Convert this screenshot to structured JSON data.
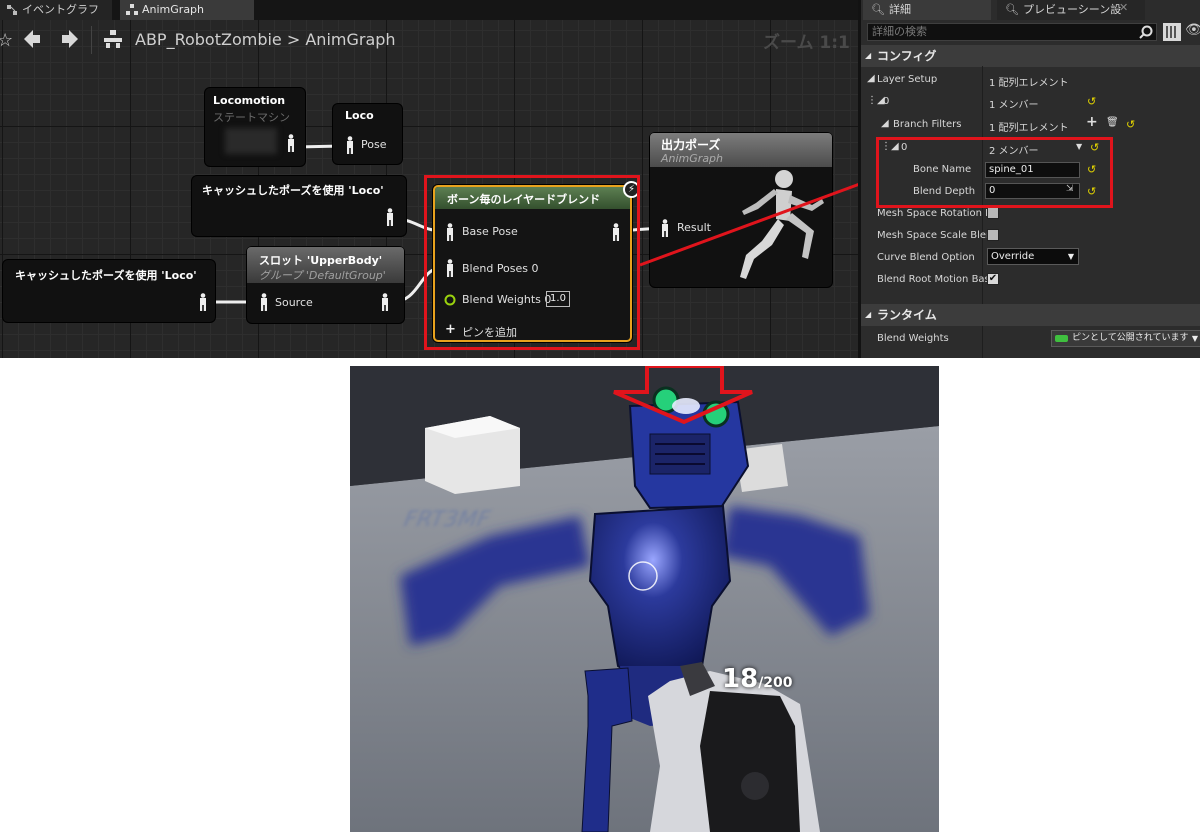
{
  "tabs": [
    {
      "label": "イベントグラフ"
    },
    {
      "label": "AnimGraph"
    }
  ],
  "breadcrumb": {
    "asset": "ABP_RobotZombie",
    "separator": ">",
    "graph": "AnimGraph"
  },
  "zoom_label": "ズーム 1:1",
  "nodes": {
    "locomotion": {
      "title": "Locomotion",
      "subtitle": "ステートマシン"
    },
    "loco": {
      "title": "Loco",
      "pin": "Pose"
    },
    "cached_pose_1": {
      "title": "キャッシュしたポーズを使用 'Loco'"
    },
    "cached_pose_2": {
      "title": "キャッシュしたポーズを使用 'Loco'"
    },
    "slot": {
      "title": "スロット 'UpperBody'",
      "subtitle": "グループ 'DefaultGroup'",
      "pin": "Source"
    },
    "blend": {
      "title": "ボーン毎のレイヤードブレンド",
      "base_pose": "Base Pose",
      "blend_poses": "Blend Poses 0",
      "blend_weights": "Blend Weights 0",
      "blend_weights_value": "1.0",
      "add_pin": "ピンを追加"
    },
    "output": {
      "title": "出力ポーズ",
      "subtitle": "AnimGraph",
      "pin": "Result"
    }
  },
  "details": {
    "tab_details": "詳細",
    "tab_preview": "プレビューシーン設",
    "search_placeholder": "詳細の検索",
    "section_config": "コンフィグ",
    "section_runtime": "ランタイム",
    "rows": {
      "layer_setup": {
        "label": "Layer Setup",
        "value": "1 配列エレメント"
      },
      "layer_0": {
        "label": "0",
        "value": "1 メンバー"
      },
      "branch_filters": {
        "label": "Branch Filters",
        "value": "1 配列エレメント"
      },
      "filter_0": {
        "label": "0",
        "value": "2 メンバー"
      },
      "bone_name": {
        "label": "Bone Name",
        "value": "spine_01"
      },
      "blend_depth": {
        "label": "Blend Depth",
        "value": "0"
      },
      "mesh_rot": {
        "label": "Mesh Space Rotation B",
        "checked": false
      },
      "mesh_scale": {
        "label": "Mesh Space Scale Blen",
        "checked": false
      },
      "curve_blend": {
        "label": "Curve Blend Option",
        "value": "Override"
      },
      "root_motion": {
        "label": "Blend Root Motion Base",
        "checked": true
      },
      "blend_weights": {
        "label": "Blend Weights",
        "value": "ピンとして公開されています"
      }
    }
  },
  "hud": {
    "ammo_current": "18",
    "ammo_total": "/200"
  }
}
